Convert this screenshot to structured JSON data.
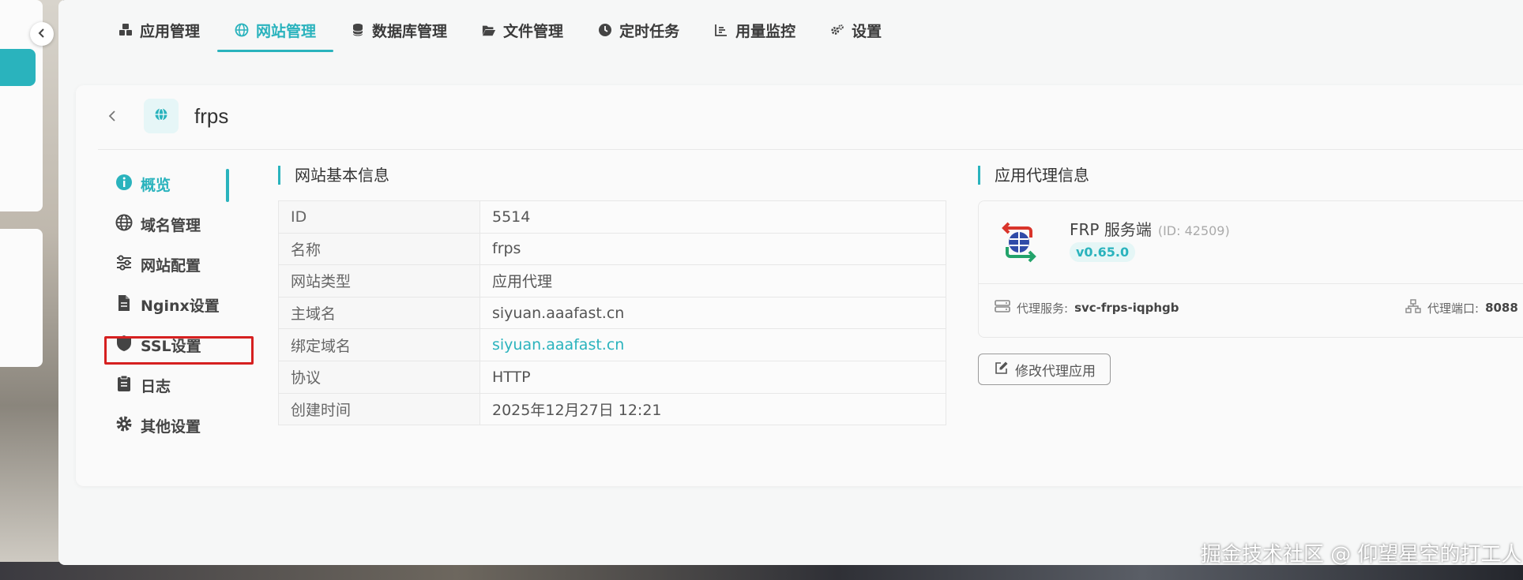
{
  "nav": {
    "items": [
      {
        "label": "应用管理",
        "icon": "cubes-icon"
      },
      {
        "label": "网站管理",
        "icon": "globe-icon",
        "active": true
      },
      {
        "label": "数据库管理",
        "icon": "database-icon"
      },
      {
        "label": "文件管理",
        "icon": "folder-open-icon"
      },
      {
        "label": "定时任务",
        "icon": "clock-icon"
      },
      {
        "label": "用量监控",
        "icon": "chart-icon"
      },
      {
        "label": "设置",
        "icon": "cogs-icon"
      }
    ]
  },
  "site": {
    "title": "frps"
  },
  "side_menu": {
    "items": [
      {
        "label": "概览",
        "icon": "info-circle-icon",
        "active": true
      },
      {
        "label": "域名管理",
        "icon": "globe-icon"
      },
      {
        "label": "网站配置",
        "icon": "sliders-icon"
      },
      {
        "label": "Nginx设置",
        "icon": "file-icon"
      },
      {
        "label": "SSL设置",
        "icon": "shield-icon"
      },
      {
        "label": "日志",
        "icon": "clipboard-icon"
      },
      {
        "label": "其他设置",
        "icon": "gear-icon"
      }
    ]
  },
  "basic_info": {
    "title": "网站基本信息",
    "rows": [
      {
        "key": "ID",
        "value": "5514"
      },
      {
        "key": "名称",
        "value": "frps"
      },
      {
        "key": "网站类型",
        "value": "应用代理"
      },
      {
        "key": "主域名",
        "value": "siyuan.aaafast.cn"
      },
      {
        "key": "绑定域名",
        "value": "siyuan.aaafast.cn"
      },
      {
        "key": "协议",
        "value": "HTTP"
      },
      {
        "key": "创建时间",
        "value": "2025年12月27日 12:21"
      }
    ]
  },
  "proxy_info": {
    "title": "应用代理信息",
    "app_name": "FRP 服务端",
    "app_id": "(ID: 42509)",
    "version": "v0.65.0",
    "service_label": "代理服务:",
    "service_value": "svc-frps-iqphgb",
    "port_label": "代理端口:",
    "port_value": "8088",
    "edit_button": "修改代理应用"
  },
  "watermark": "掘金技术社区 @ 仰望星空的打工人",
  "colors": {
    "accent": "#2ab3bd",
    "highlight_box": "#d62020"
  }
}
